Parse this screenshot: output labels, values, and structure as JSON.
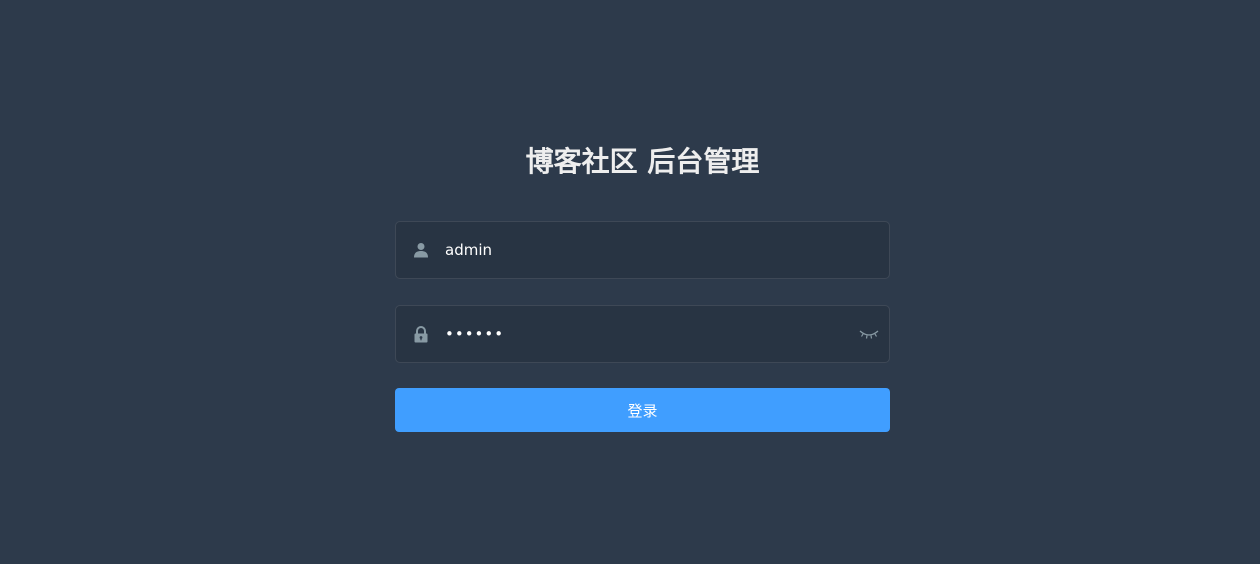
{
  "page": {
    "title": "博客社区 后台管理"
  },
  "form": {
    "username": {
      "value": "admin",
      "icon": "user-icon"
    },
    "password": {
      "value": "••••••",
      "icon": "lock-icon",
      "toggle_icon": "eye-closed-icon"
    },
    "submit_label": "登录"
  },
  "colors": {
    "background": "#2d3a4b",
    "button": "#409eff",
    "title": "#eeeeee",
    "icon": "#889aa4"
  }
}
